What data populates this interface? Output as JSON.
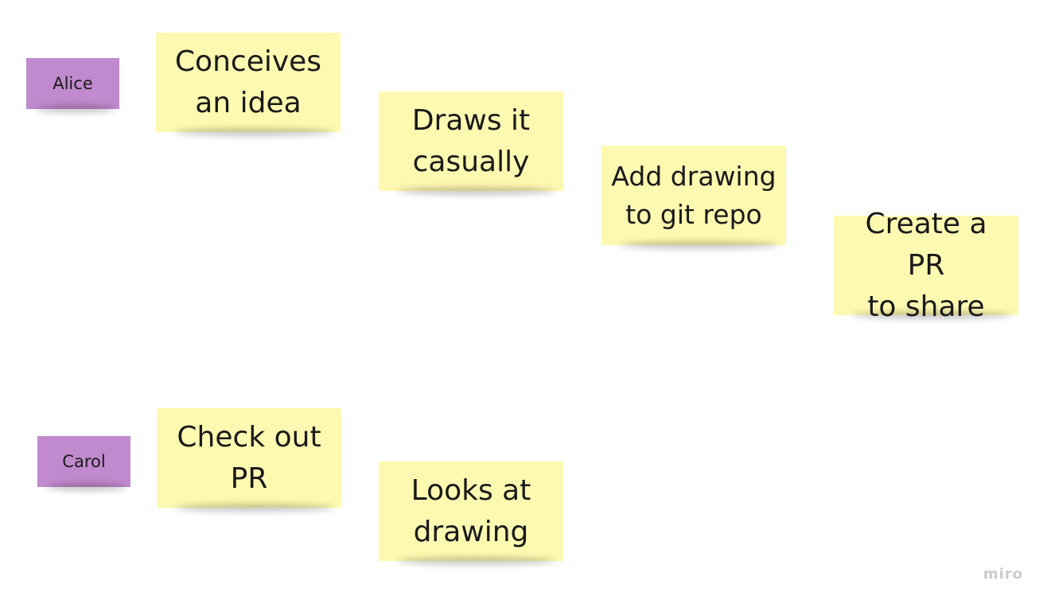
{
  "board": {
    "people": [
      {
        "label": "Alice"
      },
      {
        "label": "Carol"
      }
    ],
    "alice_notes": [
      {
        "text": "Conceives\nan idea"
      },
      {
        "text": "Draws  it\ncasually"
      },
      {
        "text": "Add drawing\nto git repo"
      },
      {
        "text": "Create a PR\nto share"
      }
    ],
    "carol_notes": [
      {
        "text": "Check out\nPR"
      },
      {
        "text": "Looks at\ndrawing"
      }
    ]
  },
  "branding": {
    "logo": "miro"
  },
  "colors": {
    "sticky_yellow": "#fef9b1",
    "person_purple": "#c18ace",
    "background": "#ffffff"
  }
}
